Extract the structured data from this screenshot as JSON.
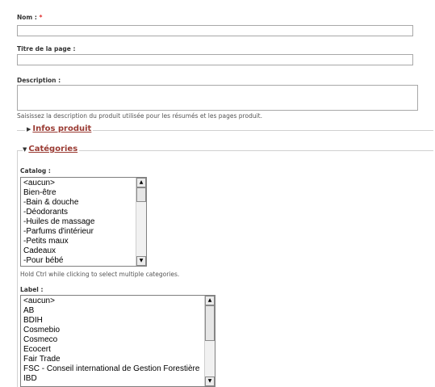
{
  "fields": {
    "nom": {
      "label": "Nom :",
      "required_mark": "*",
      "value": ""
    },
    "titre": {
      "label": "Titre de la page :",
      "value": ""
    },
    "description": {
      "label": "Description :",
      "value": "",
      "help": "Saisissez la description du produit utilisée pour les résumés et les pages produit."
    }
  },
  "sections": {
    "infos": {
      "label": "Infos produit",
      "expanded": false,
      "toggle_glyph": "▶"
    },
    "categories": {
      "label": "Catégories",
      "expanded": true,
      "toggle_glyph": "▼"
    }
  },
  "catalog": {
    "label": "Catalog :",
    "options": [
      "<aucun>",
      "Bien-être",
      "-Bain & douche",
      "-Déodorants",
      "-Huiles de massage",
      "-Parfums d'intérieur",
      "-Petits maux",
      "Cadeaux",
      "-Pour bébé"
    ],
    "help": "Hold Ctrl while clicking to select multiple categories."
  },
  "label_list": {
    "label": "Label :",
    "options": [
      "<aucun>",
      "AB",
      "BDIH",
      "Cosmebio",
      "Cosmeco",
      "Ecocert",
      "Fair Trade",
      "FSC - Conseil international de Gestion Forestière",
      "IBD"
    ]
  },
  "scroll_arrows": {
    "up": "▲",
    "down": "▼"
  },
  "colors": {
    "required": "#e03030",
    "legend_link": "#9a3b33",
    "border": "#a8a8a8"
  }
}
